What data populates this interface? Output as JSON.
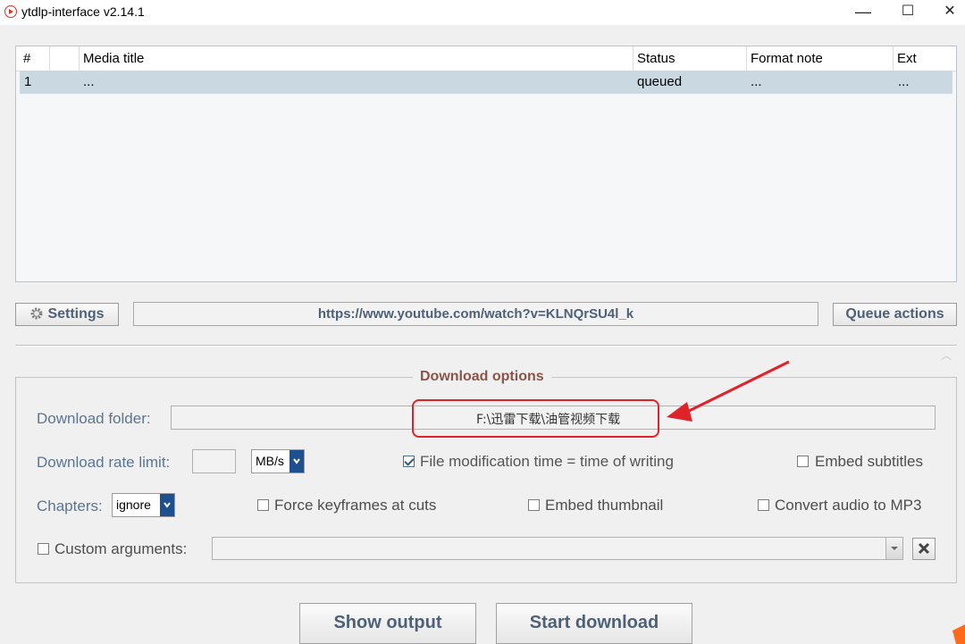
{
  "window": {
    "title": "ytdlp-interface v2.14.1",
    "minimize": "—",
    "maximize": "☐",
    "close": "✕"
  },
  "queue": {
    "columns": [
      "#",
      "",
      "Media title",
      "Status",
      "Format note",
      "Ext"
    ],
    "rows": [
      {
        "num": "1",
        "icon": "",
        "title": "...",
        "status": "queued",
        "format_note": "...",
        "ext": "..."
      }
    ]
  },
  "toolbar": {
    "settings_label": "Settings",
    "url": "https://www.youtube.com/watch?v=KLNQrSU4l_k",
    "queue_actions_label": "Queue actions"
  },
  "options": {
    "legend": "Download options",
    "download_folder_label": "Download folder:",
    "download_folder_value": "F:\\迅雷下载\\油管视频下载",
    "rate_limit_label": "Download rate limit:",
    "rate_limit_value": "",
    "rate_unit": "MB/s",
    "file_mod_time_label": "File modification time = time of writing",
    "file_mod_time_checked": true,
    "embed_subtitles_label": "Embed subtitles",
    "embed_subtitles_checked": false,
    "chapters_label": "Chapters:",
    "chapters_value": "ignore",
    "force_keyframes_label": "Force keyframes at cuts",
    "force_keyframes_checked": false,
    "embed_thumbnail_label": "Embed thumbnail",
    "embed_thumbnail_checked": false,
    "convert_mp3_label": "Convert audio to MP3",
    "convert_mp3_checked": false,
    "custom_args_label": "Custom arguments:",
    "custom_args_checked": false,
    "custom_args_value": ""
  },
  "actions": {
    "show_output": "Show output",
    "start_download": "Start download"
  },
  "annotation": {
    "color": "#e0222a"
  }
}
